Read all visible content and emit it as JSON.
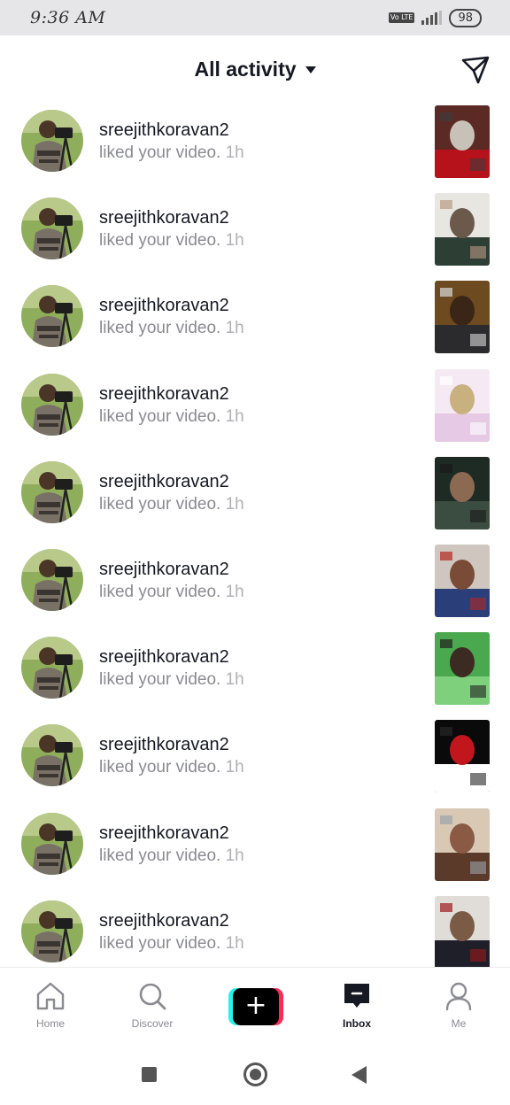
{
  "status_bar": {
    "time": "9:36 AM",
    "volte_label": "Vo LTE",
    "battery": "98"
  },
  "header": {
    "title": "All activity",
    "send_icon": "send-icon",
    "dropdown_icon": "caret-down-icon"
  },
  "notifications": [
    {
      "username": "sreejithkoravan2",
      "action": "liked your video.",
      "time": "1h",
      "thumb_palette": [
        "#5b2a25",
        "#c8c1b8",
        "#b5121b",
        "#3c3c3c"
      ]
    },
    {
      "username": "sreejithkoravan2",
      "action": "liked your video.",
      "time": "1h",
      "thumb_palette": [
        "#e8e6e0",
        "#6b5a4c",
        "#2d3e34",
        "#b99a84"
      ]
    },
    {
      "username": "sreejithkoravan2",
      "action": "liked your video.",
      "time": "1h",
      "thumb_palette": [
        "#6d4a1f",
        "#3a2617",
        "#2b2b2e",
        "#d8d8d8"
      ]
    },
    {
      "username": "sreejithkoravan2",
      "action": "liked your video.",
      "time": "1h",
      "thumb_palette": [
        "#f5e9f4",
        "#c8b07f",
        "#e6c9e5",
        "#ffffff"
      ]
    },
    {
      "username": "sreejithkoravan2",
      "action": "liked your video.",
      "time": "1h",
      "thumb_palette": [
        "#1e2a24",
        "#8c6a52",
        "#3b4c40",
        "#1a1a1a"
      ]
    },
    {
      "username": "sreejithkoravan2",
      "action": "liked your video.",
      "time": "1h",
      "thumb_palette": [
        "#cfc7bf",
        "#7a4b36",
        "#2a3f7a",
        "#b3261e"
      ]
    },
    {
      "username": "sreejithkoravan2",
      "action": "liked your video.",
      "time": "1h",
      "thumb_palette": [
        "#4aa84f",
        "#3b2b22",
        "#7fd07d",
        "#1f1f1f"
      ]
    },
    {
      "username": "sreejithkoravan2",
      "action": "liked your video.",
      "time": "1h",
      "thumb_palette": [
        "#0a0a0a",
        "#c0161c",
        "#ffffff",
        "#262626"
      ]
    },
    {
      "username": "sreejithkoravan2",
      "action": "liked your video.",
      "time": "1h",
      "thumb_palette": [
        "#d9c8b4",
        "#8a5a44",
        "#5c3a2a",
        "#9aa3ad"
      ]
    },
    {
      "username": "sreejithkoravan2",
      "action": "liked your video.",
      "time": "1h",
      "thumb_palette": [
        "#e0ddd8",
        "#7c5b46",
        "#1f1f2a",
        "#9b1b1b"
      ]
    }
  ],
  "bottom_nav": {
    "home": "Home",
    "discover": "Discover",
    "create_icon": "plus-icon",
    "inbox": "Inbox",
    "me": "Me",
    "active": "inbox"
  },
  "android_nav": {
    "recents_icon": "square-icon",
    "home_icon": "circle-icon",
    "back_icon": "back-triangle-icon"
  },
  "colors": {
    "text_primary": "#161823",
    "text_secondary": "#8a8b91",
    "accent_cyan": "#25f4ee",
    "accent_pink": "#fe2c55"
  }
}
